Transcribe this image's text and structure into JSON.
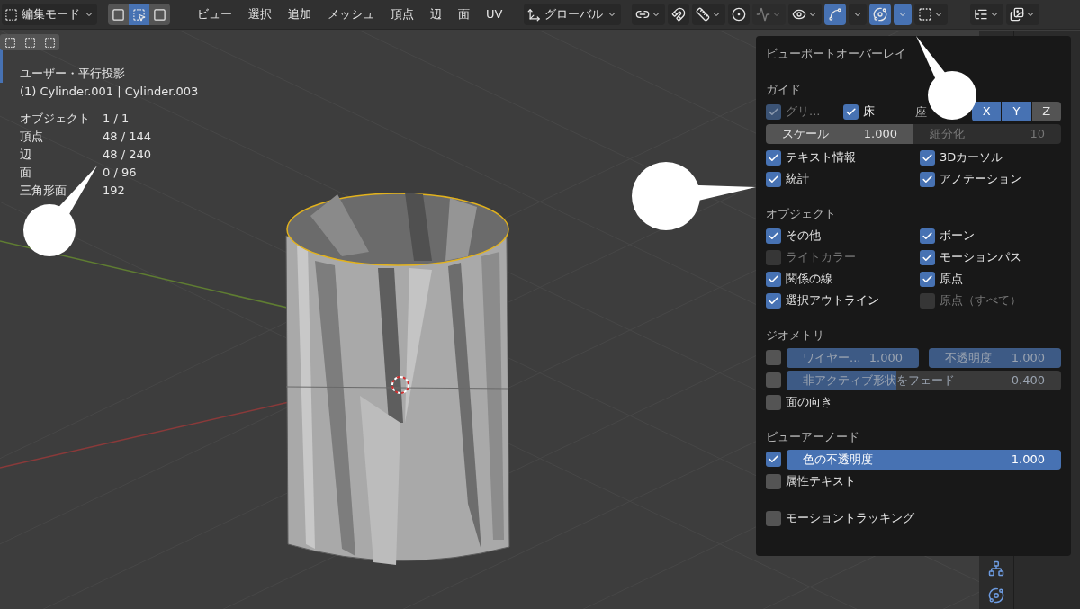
{
  "header": {
    "mode": "編集モード",
    "select_modes": [
      {
        "kind": "vertex",
        "selected": false
      },
      {
        "kind": "edge",
        "selected": true
      },
      {
        "kind": "face",
        "selected": false
      }
    ],
    "menus": [
      "ビュー",
      "選択",
      "追加",
      "メッシュ",
      "頂点",
      "辺",
      "面",
      "UV"
    ],
    "orientation": "グローバル",
    "tools": [
      {
        "kind": "pivot",
        "selected": false,
        "caret": true,
        "disabled": false
      },
      {
        "kind": "snap",
        "selected": false,
        "caret": false,
        "disabled": false
      },
      {
        "kind": "snap_target",
        "selected": false,
        "caret": true,
        "disabled": false
      },
      {
        "kind": "proportional",
        "selected": false,
        "caret": false,
        "disabled": false
      },
      {
        "kind": "falloff",
        "selected": false,
        "caret": true,
        "disabled": true
      },
      {
        "kind": "visibility",
        "selected": false,
        "caret": true,
        "disabled": false
      },
      {
        "kind": "gizmo",
        "selected": true,
        "caret": false,
        "disabled": false
      },
      {
        "kind": "gizmo_menu",
        "selected": false,
        "caret": true,
        "disabled": false
      },
      {
        "kind": "overlay",
        "selected": true,
        "caret": false,
        "disabled": false
      },
      {
        "kind": "overlay_menu",
        "selected": true,
        "caret": true,
        "disabled": false
      },
      {
        "kind": "mesh_overlay",
        "selected": false,
        "caret": true,
        "disabled": false
      },
      {
        "kind": "editor_type",
        "selected": false,
        "caret": true,
        "disabled": false
      },
      {
        "kind": "display_mode",
        "selected": false,
        "caret": true,
        "disabled": false
      }
    ]
  },
  "viewport": {
    "view_name": "ユーザー・平行投影",
    "object_name": "(1) Cylinder.001 | Cylinder.003",
    "stats": [
      {
        "label": "オブジェクト",
        "value": "1 / 1"
      },
      {
        "label": "頂点",
        "value": "48 / 144"
      },
      {
        "label": "辺",
        "value": "48 / 240"
      },
      {
        "label": "面",
        "value": "0 / 96"
      },
      {
        "label": "三角形面",
        "value": "192"
      }
    ]
  },
  "panel": {
    "title": "ビューポートオーバーレイ",
    "guide": {
      "title": "ガイド",
      "grid": {
        "label": "グリ...",
        "checked": true,
        "disabled": true
      },
      "floor": {
        "label": "床",
        "checked": true,
        "disabled": false
      },
      "axes_label": "座",
      "axes": [
        {
          "label": "X",
          "selected": true
        },
        {
          "label": "Y",
          "selected": true
        },
        {
          "label": "Z",
          "selected": false
        }
      ],
      "scale": {
        "label": "スケール",
        "value": "1.000",
        "disabled": false
      },
      "subdivision": {
        "label": "細分化",
        "value": "10",
        "disabled": true
      },
      "checks": [
        {
          "label": "テキスト情報",
          "checked": true,
          "disabled": false
        },
        {
          "label": "3Dカーソル",
          "checked": true,
          "disabled": false
        },
        {
          "label": "統計",
          "checked": true,
          "disabled": false
        },
        {
          "label": "アノテーション",
          "checked": true,
          "disabled": false
        }
      ]
    },
    "sections": [
      {
        "title": "オブジェクト",
        "items": [
          {
            "kind": "half",
            "label": "その他",
            "checked": true,
            "disabled": false
          },
          {
            "kind": "half",
            "label": "ボーン",
            "checked": true,
            "disabled": false
          },
          {
            "kind": "half",
            "label": "ライトカラー",
            "checked": false,
            "disabled": true
          },
          {
            "kind": "half",
            "label": "モーションパス",
            "checked": true,
            "disabled": false
          },
          {
            "kind": "half",
            "label": "関係の線",
            "checked": true,
            "disabled": false
          },
          {
            "kind": "half",
            "label": "原点",
            "checked": true,
            "disabled": false
          },
          {
            "kind": "half",
            "label": "選択アウトライン",
            "checked": true,
            "disabled": false
          },
          {
            "kind": "half",
            "label": "原点（すべて）",
            "checked": false,
            "disabled": true
          }
        ]
      },
      {
        "title": "ジオメトリ",
        "items": [
          {
            "kind": "check_sliders",
            "checked": false,
            "sliders": [
              {
                "label": "ワイヤー...",
                "value": "1.000",
                "level": 1,
                "disabled": true
              },
              {
                "label": "不透明度",
                "value": "1.000",
                "level": 1,
                "disabled": true
              }
            ]
          },
          {
            "kind": "check_sliders",
            "checked": false,
            "sliders": [
              {
                "label": "非アクティブ形状をフェード",
                "value": "0.400",
                "level": 0.4,
                "disabled": true
              }
            ]
          },
          {
            "kind": "check",
            "label": "面の向き",
            "checked": false,
            "disabled": false
          }
        ]
      },
      {
        "title": "ビューアーノード",
        "items": [
          {
            "kind": "check_sliders",
            "checked": true,
            "sliders": [
              {
                "label": "色の不透明度",
                "value": "1.000",
                "level": 1,
                "disabled": false
              }
            ]
          },
          {
            "kind": "check",
            "label": "属性テキスト",
            "checked": false,
            "disabled": false
          }
        ]
      },
      {
        "items": [
          {
            "kind": "check",
            "label": "モーショントラッキング",
            "checked": false,
            "disabled": false
          }
        ]
      }
    ]
  }
}
